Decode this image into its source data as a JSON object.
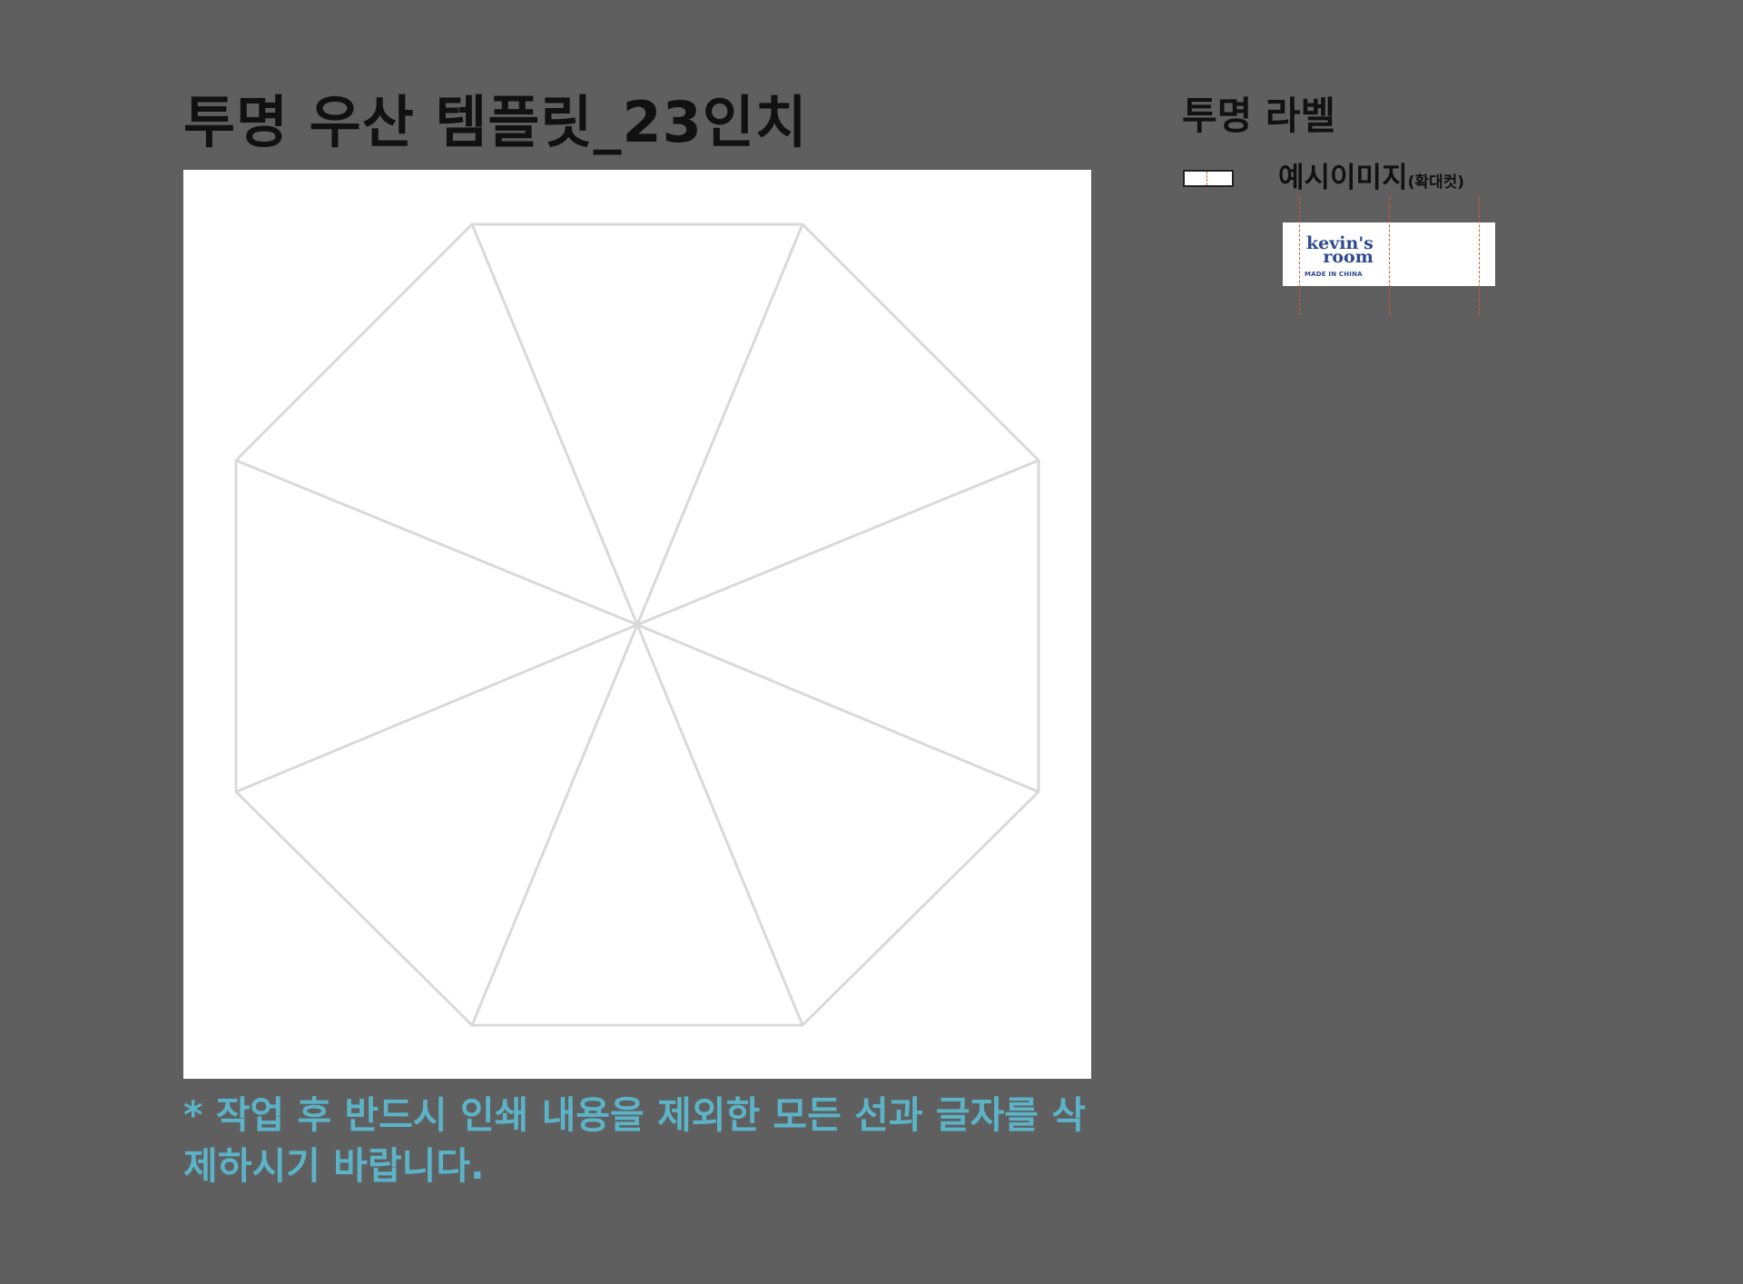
{
  "page": {
    "title": "투명 우산 템플릿_23인치",
    "note": "* 작업 후 반드시 인쇄 내용을 제외한 모든 선과 글자를 삭제하시기 바랍니다."
  },
  "label_section": {
    "title": "투명 라벨",
    "example_title": "예시이미지",
    "example_suffix": "(확대컷)",
    "brand_line1": "kevin's",
    "brand_line2": "room",
    "made_in": "MADE IN CHINA"
  },
  "colors": {
    "background": "#5f5f5f",
    "note_text": "#5cb3c7",
    "template_lines": "#d9d9d9",
    "brand": "#2f4a8f",
    "cut_line": "#e05535"
  }
}
